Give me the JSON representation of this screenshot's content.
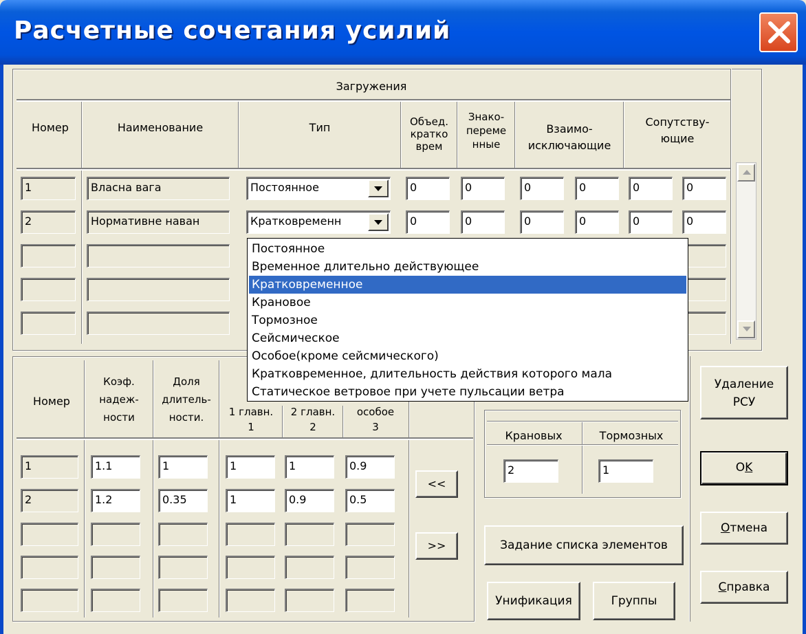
{
  "window": {
    "title": "Расчетные сочетания усилий"
  },
  "top": {
    "group_title": "Загружения",
    "headers": {
      "number": "Номер",
      "name": "Наименование",
      "type": "Тип",
      "comb_l1": "Объед.",
      "comb_l2": "кратко",
      "comb_l3": "врем",
      "sign_l1": "Знако-",
      "sign_l2": "переме",
      "sign_l3": "нные",
      "excl_l1": "Взаимо-",
      "excl_l2": "исключающие",
      "acc_l1": "Сопутству-",
      "acc_l2": "ющие"
    },
    "rows": [
      {
        "num": "1",
        "name": "Власна вага",
        "type": "Постоянное",
        "comb": "0",
        "sign": "0",
        "excl1": "0",
        "excl2": "0",
        "acc1": "0",
        "acc2": "0"
      },
      {
        "num": "2",
        "name": "Нормативне наван",
        "type": "Кратковременн",
        "comb": "0",
        "sign": "0",
        "excl1": "0",
        "excl2": "0",
        "acc1": "0",
        "acc2": "0"
      }
    ]
  },
  "dropdown": {
    "items": [
      "Постоянное",
      "Временное длительно действующее",
      "Кратковременное",
      "Крановое",
      "Тормозное",
      "Сейсмическое",
      "Особое(кроме сейсмического)",
      "Кратковременное, длительность действия которого мала",
      "Статическое ветровое при учете пульсации ветра"
    ],
    "selected_index": 2
  },
  "bottom": {
    "headers": {
      "number": "Номер",
      "coef_l1": "Коэф.",
      "coef_l2": "надеж-",
      "coef_l3": "ности",
      "dur_l1": "Доля",
      "dur_l2": "длитель-",
      "dur_l3": "ности.",
      "c1_l1": "1 главн.",
      "c1_l2": "1",
      "c2_l1": "2 главн.",
      "c2_l2": "2",
      "c3_l1": "особое",
      "c3_l2": "3"
    },
    "rows": [
      {
        "num": "1",
        "coef": "1.1",
        "dur": "1",
        "c1": "1",
        "c2": "1",
        "c3": "0.9"
      },
      {
        "num": "2",
        "coef": "1.2",
        "dur": "0.35",
        "c1": "1",
        "c2": "0.9",
        "c3": "0.5"
      }
    ]
  },
  "cranes": {
    "crane_label": "Крановых",
    "brake_label": "Тормозных",
    "crane_value": "2",
    "brake_value": "1"
  },
  "buttons": {
    "move_left": "<<",
    "move_right": ">>",
    "element_list": "Задание списка элементов",
    "unify": "Унификация",
    "groups": "Группы",
    "delete_l1": "Удаление",
    "delete_l2": "РСУ",
    "ok_pre": "О",
    "ok_key": "K",
    "cancel_key": "О",
    "cancel_rest": "тмена",
    "help_key": "С",
    "help_rest": "правка"
  }
}
